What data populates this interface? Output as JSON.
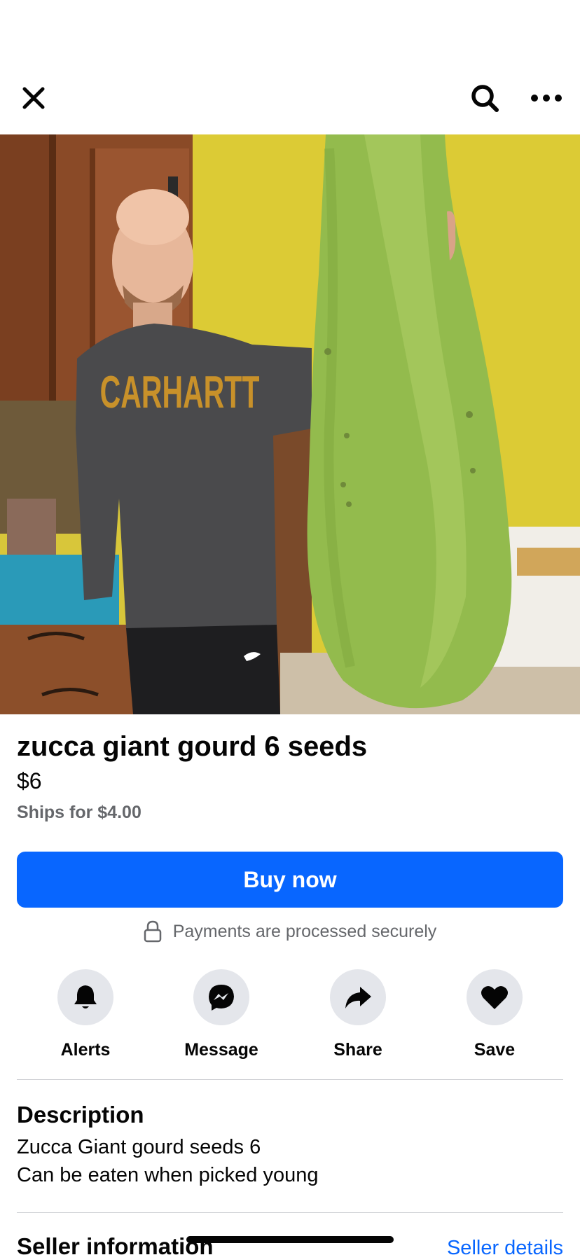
{
  "header": {
    "close_icon": "close-icon",
    "search_icon": "search-icon",
    "more_icon": "more-horizontal-icon"
  },
  "photo": {
    "sweatshirt_text": "CARHARTT",
    "image_count": 2,
    "active_index": 2
  },
  "listing": {
    "title": "zucca giant gourd 6 seeds",
    "price": "$6",
    "shipping": "Ships for $4.00"
  },
  "buy": {
    "label": "Buy now",
    "color": "#0866ff"
  },
  "secure": {
    "text": "Payments are processed securely",
    "icon": "lock-icon"
  },
  "actions": [
    {
      "label": "Alerts",
      "icon": "bell-icon"
    },
    {
      "label": "Message",
      "icon": "messenger-icon"
    },
    {
      "label": "Share",
      "icon": "share-arrow-icon"
    },
    {
      "label": "Save",
      "icon": "heart-icon"
    }
  ],
  "description": {
    "heading": "Description",
    "text": "Zucca Giant gourd seeds 6\nCan be eaten when picked young"
  },
  "seller": {
    "heading": "Seller information",
    "link": "Seller details"
  }
}
